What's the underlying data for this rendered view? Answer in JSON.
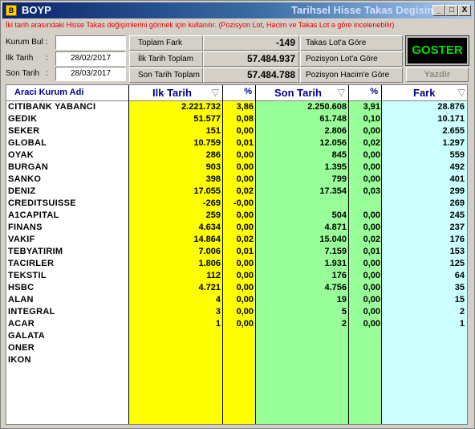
{
  "app": {
    "name": "BOYP",
    "title": "Tarihsel Hisse Takas Degisimi",
    "min_btn": "_",
    "max_btn": "□",
    "close_btn": "X"
  },
  "info_text": "İki tarih arasındaki Hisse Takas değişimlerini görmek için kullanılır. (Pozisyon Lot, Hacim ve Takas Lot a göre incelenebilir)",
  "form": {
    "kurum_bul_label": "Kurum Bul :",
    "kurum_bul_value": "",
    "ilk_tarih_label": "Ilk Tarih",
    "ilk_tarih_colon": ":",
    "ilk_tarih_value": "28/02/2017",
    "son_tarih_label": "Son Tarih",
    "son_tarih_colon": ":",
    "son_tarih_value": "28/03/2017"
  },
  "summary": {
    "toplam_fark_label": "Toplam Fark",
    "toplam_fark_value": "-149",
    "ilk_tarih_toplam_label": "İlk Tarih Toplam",
    "ilk_tarih_toplam_value": "57.484.937",
    "son_tarih_toplam_label": "Son Tarih Toplam",
    "son_tarih_toplam_value": "57.484.788"
  },
  "options": {
    "takas_lot": "Takas Lot'a Göre",
    "pozisyon_lot": "Pozisyon Lot'a Göre",
    "pozisyon_hacim": "Pozisyon Hacim'e Göre"
  },
  "buttons": {
    "goster": "GOSTER",
    "yazdir": "Yazdir"
  },
  "colors": {
    "yellow": "#ffff00",
    "green": "#99ff99",
    "cyan": "#ccffff",
    "white": "#ffffff",
    "error_text": "#e00000",
    "goster_text": "#00e000"
  },
  "table": {
    "headers": {
      "kurum": "Araci Kurum Adi",
      "ilk": "Ilk Tarih",
      "ilk_pct": "%",
      "son": "Son Tarih",
      "son_pct": "%",
      "fark": "Fark"
    },
    "sort_icon": "▽",
    "rows": [
      {
        "name": "CITIBANK YABANCI",
        "ilk": "2.221.732",
        "ilk_pct": "3,86",
        "son": "2.250.608",
        "son_pct": "3,91",
        "fark": "28.876"
      },
      {
        "name": "GEDIK",
        "ilk": "51.577",
        "ilk_pct": "0,08",
        "son": "61.748",
        "son_pct": "0,10",
        "fark": "10.171"
      },
      {
        "name": "SEKER",
        "ilk": "151",
        "ilk_pct": "0,00",
        "son": "2.806",
        "son_pct": "0,00",
        "fark": "2.655"
      },
      {
        "name": "GLOBAL",
        "ilk": "10.759",
        "ilk_pct": "0,01",
        "son": "12.056",
        "son_pct": "0,02",
        "fark": "1.297"
      },
      {
        "name": "OYAK",
        "ilk": "286",
        "ilk_pct": "0,00",
        "son": "845",
        "son_pct": "0,00",
        "fark": "559"
      },
      {
        "name": "BURGAN",
        "ilk": "903",
        "ilk_pct": "0,00",
        "son": "1.395",
        "son_pct": "0,00",
        "fark": "492"
      },
      {
        "name": "SANKO",
        "ilk": "398",
        "ilk_pct": "0,00",
        "son": "799",
        "son_pct": "0,00",
        "fark": "401"
      },
      {
        "name": "DENIZ",
        "ilk": "17.055",
        "ilk_pct": "0,02",
        "son": "17.354",
        "son_pct": "0,03",
        "fark": "299"
      },
      {
        "name": "CREDITSUISSE",
        "ilk": "-269",
        "ilk_pct": "-0,00",
        "son": "",
        "son_pct": "",
        "fark": "269"
      },
      {
        "name": "A1CAPITAL",
        "ilk": "259",
        "ilk_pct": "0,00",
        "son": "504",
        "son_pct": "0,00",
        "fark": "245"
      },
      {
        "name": "FINANS",
        "ilk": "4.634",
        "ilk_pct": "0,00",
        "son": "4.871",
        "son_pct": "0,00",
        "fark": "237"
      },
      {
        "name": "VAKIF",
        "ilk": "14.864",
        "ilk_pct": "0,02",
        "son": "15.040",
        "son_pct": "0,02",
        "fark": "176"
      },
      {
        "name": "TEBYATIRIM",
        "ilk": "7.006",
        "ilk_pct": "0,01",
        "son": "7.159",
        "son_pct": "0,01",
        "fark": "153"
      },
      {
        "name": "TACIRLER",
        "ilk": "1.806",
        "ilk_pct": "0,00",
        "son": "1.931",
        "son_pct": "0,00",
        "fark": "125"
      },
      {
        "name": "TEKSTIL",
        "ilk": "112",
        "ilk_pct": "0,00",
        "son": "176",
        "son_pct": "0,00",
        "fark": "64"
      },
      {
        "name": "HSBC",
        "ilk": "4.721",
        "ilk_pct": "0,00",
        "son": "4.756",
        "son_pct": "0,00",
        "fark": "35"
      },
      {
        "name": "ALAN",
        "ilk": "4",
        "ilk_pct": "0,00",
        "son": "19",
        "son_pct": "0,00",
        "fark": "15"
      },
      {
        "name": "INTEGRAL",
        "ilk": "3",
        "ilk_pct": "0,00",
        "son": "5",
        "son_pct": "0,00",
        "fark": "2"
      },
      {
        "name": "ACAR",
        "ilk": "1",
        "ilk_pct": "0,00",
        "son": "2",
        "son_pct": "0,00",
        "fark": "1"
      },
      {
        "name": "GALATA",
        "ilk": "",
        "ilk_pct": "",
        "son": "",
        "son_pct": "",
        "fark": ""
      },
      {
        "name": "ONER",
        "ilk": "",
        "ilk_pct": "",
        "son": "",
        "son_pct": "",
        "fark": ""
      },
      {
        "name": "IKON",
        "ilk": "",
        "ilk_pct": "",
        "son": "",
        "son_pct": "",
        "fark": ""
      }
    ]
  }
}
